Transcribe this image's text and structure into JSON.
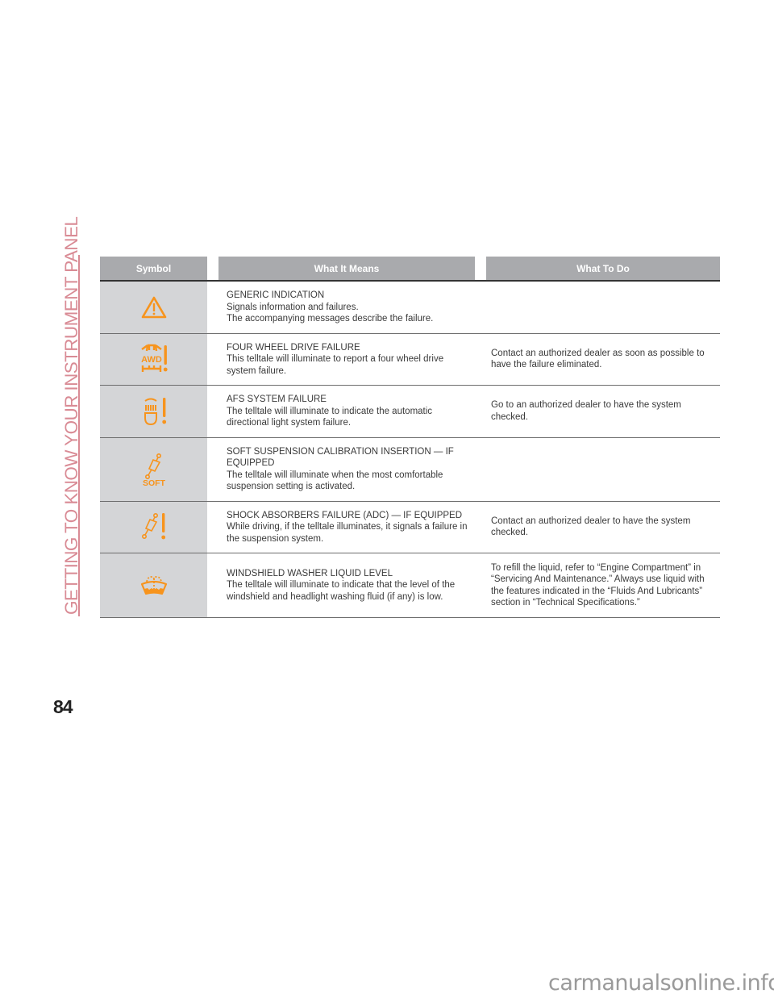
{
  "side_title": "GETTING TO KNOW YOUR INSTRUMENT PANEL",
  "page_number": "84",
  "watermark": "carmanualsonline.info",
  "colors": {
    "telltale": "#f7941d",
    "header_bg": "#a9aaad",
    "symbol_bg": "#d4d5d7",
    "side_title": "#d98b95"
  },
  "table": {
    "headers": {
      "symbol": "Symbol",
      "means": "What It Means",
      "todo": "What To Do"
    },
    "rows": [
      {
        "icon": "warning-triangle-icon",
        "title": "GENERIC INDICATION",
        "desc1": "Signals information and failures.",
        "desc2": "The accompanying messages describe the failure.",
        "todo": ""
      },
      {
        "icon": "awd-failure-icon",
        "title": "FOUR WHEEL DRIVE FAILURE",
        "desc1": "This telltale will illuminate to report a four wheel drive system failure.",
        "desc2": "",
        "todo": "Contact an authorized dealer as soon as possible to have the failure eliminated.",
        "icon_label": "AWD"
      },
      {
        "icon": "afs-failure-icon",
        "title": "AFS SYSTEM FAILURE",
        "desc1": "The telltale will illuminate to indicate the automatic directional light system failure.",
        "desc2": "",
        "todo": "Go to an authorized dealer to have the system checked."
      },
      {
        "icon": "soft-suspension-icon",
        "title": "SOFT SUSPENSION CALIBRATION INSERTION — IF EQUIPPED",
        "desc1": "The telltale will illuminate when the most comfortable suspension setting is activated.",
        "desc2": "",
        "todo": "",
        "icon_label": "SOFT"
      },
      {
        "icon": "shock-absorber-failure-icon",
        "title": "SHOCK ABSORBERS FAILURE (ADC) — IF EQUIPPED",
        "desc1": "While driving, if the telltale illuminates, it signals a failure in the suspension system.",
        "desc2": "",
        "todo": "Contact an authorized dealer to have the system checked."
      },
      {
        "icon": "washer-fluid-icon",
        "title": "WINDSHIELD WASHER LIQUID LEVEL",
        "desc1": "The telltale will illuminate to indicate that the level of the windshield and headlight washing fluid (if any) is low.",
        "desc2": "",
        "todo": "To refill the liquid, refer to “Engine Compartment” in “Servicing And Maintenance.” Always use liquid with the features indicated in the “Fluids And Lubricants” section in “Technical Specifications.”"
      }
    ]
  }
}
